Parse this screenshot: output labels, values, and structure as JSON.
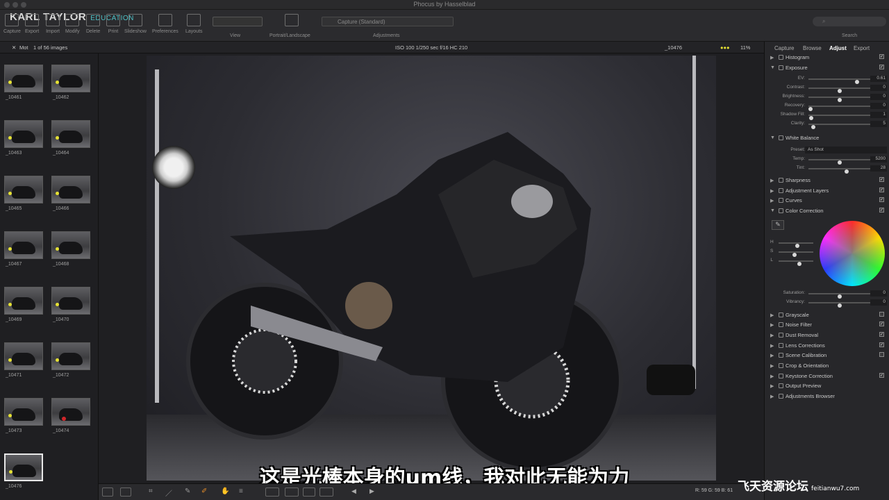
{
  "window": {
    "title": "Phocus by Hasselblad"
  },
  "logo": {
    "name": "KARL TAYLOR",
    "sub": "EDUCATION"
  },
  "toolbar": {
    "items": [
      {
        "label": "Capture",
        "icon": "camera-icon"
      },
      {
        "label": "Export",
        "icon": "export-icon"
      },
      {
        "label": "Import",
        "icon": "import-icon"
      },
      {
        "label": "Modify",
        "icon": "modify-icon"
      },
      {
        "label": "Delete",
        "icon": "trash-icon"
      },
      {
        "label": "Print",
        "icon": "print-icon"
      },
      {
        "label": "Slideshow",
        "icon": "slideshow-icon"
      },
      {
        "label": "Preferences",
        "icon": "preferences-icon"
      },
      {
        "label": "Layouts",
        "icon": "layouts-icon"
      }
    ],
    "view_label": "View",
    "portrait_label": "Portrait/Landscape",
    "capture_preset": "Capture (Standard)",
    "adjustments_label": "Adjustments",
    "search_label": "Search"
  },
  "infostrip": {
    "tab": "Mot",
    "count": "1 of 56 images",
    "exif": "ISO 100  1/250 sec  f/16  HC 210",
    "filename": "_10476",
    "zoom": "11%"
  },
  "thumbnails": [
    {
      "label": "_10461"
    },
    {
      "label": "_10462"
    },
    {
      "label": "_10463"
    },
    {
      "label": "_10464"
    },
    {
      "label": "_10465"
    },
    {
      "label": "_10466"
    },
    {
      "label": "_10467"
    },
    {
      "label": "_10468"
    },
    {
      "label": "_10469"
    },
    {
      "label": "_10470"
    },
    {
      "label": "_10471"
    },
    {
      "label": "_10472"
    },
    {
      "label": "_10473"
    },
    {
      "label": "_10474"
    },
    {
      "label": "_10476"
    }
  ],
  "panel": {
    "tabs": [
      "Capture",
      "Browse",
      "Adjust",
      "Export"
    ],
    "active_tab": "Adjust",
    "tools": {
      "histogram": "Histogram",
      "exposure": "Exposure",
      "white_balance": "White Balance",
      "sharpness": "Sharpness",
      "adjustment_layers": "Adjustment Layers",
      "curves": "Curves",
      "color_correction": "Color Correction",
      "grayscale": "Grayscale",
      "noise_filter": "Noise Filter",
      "dust_removal": "Dust Removal",
      "lens_corrections": "Lens Corrections",
      "scene_calibration": "Scene Calibration",
      "crop": "Crop & Orientation",
      "keystone": "Keystone Correction",
      "output_preview": "Output Preview",
      "adj_browser": "Adjustments Browser"
    },
    "exposure": {
      "ev": {
        "label": "EV:",
        "value": "0.61",
        "level": 0.8
      },
      "contrast": {
        "label": "Contrast:",
        "value": "0",
        "level": 0.5
      },
      "brightness": {
        "label": "Brightness:",
        "value": "0",
        "level": 0.5
      },
      "recovery": {
        "label": "Recovery:",
        "value": "0",
        "level": 0.0
      },
      "shadow": {
        "label": "Shadow Fill:",
        "value": "1",
        "level": 0.01
      },
      "clarity": {
        "label": "Clarity:",
        "value": "5",
        "level": 0.05
      }
    },
    "wb": {
      "preset_label": "Preset:",
      "preset_value": "As Shot",
      "temp": {
        "label": "Temp:",
        "value": "5200",
        "level": 0.5
      },
      "tint": {
        "label": "Tint:",
        "value": "28",
        "level": 0.62
      }
    },
    "cc": {
      "h": "H",
      "s": "S",
      "l": "L",
      "saturation": {
        "label": "Saturation:",
        "value": "0",
        "level": 0.5
      },
      "vibrancy": {
        "label": "Vibrancy:",
        "value": "0",
        "level": 0.5
      }
    }
  },
  "readout": "R: 59  G: 59  B: 61",
  "subtitle": "这是光棒本身的um线，我对此无能为力",
  "watermark": {
    "text": "飞天资源论坛",
    "url": "feitianwu7.com"
  }
}
